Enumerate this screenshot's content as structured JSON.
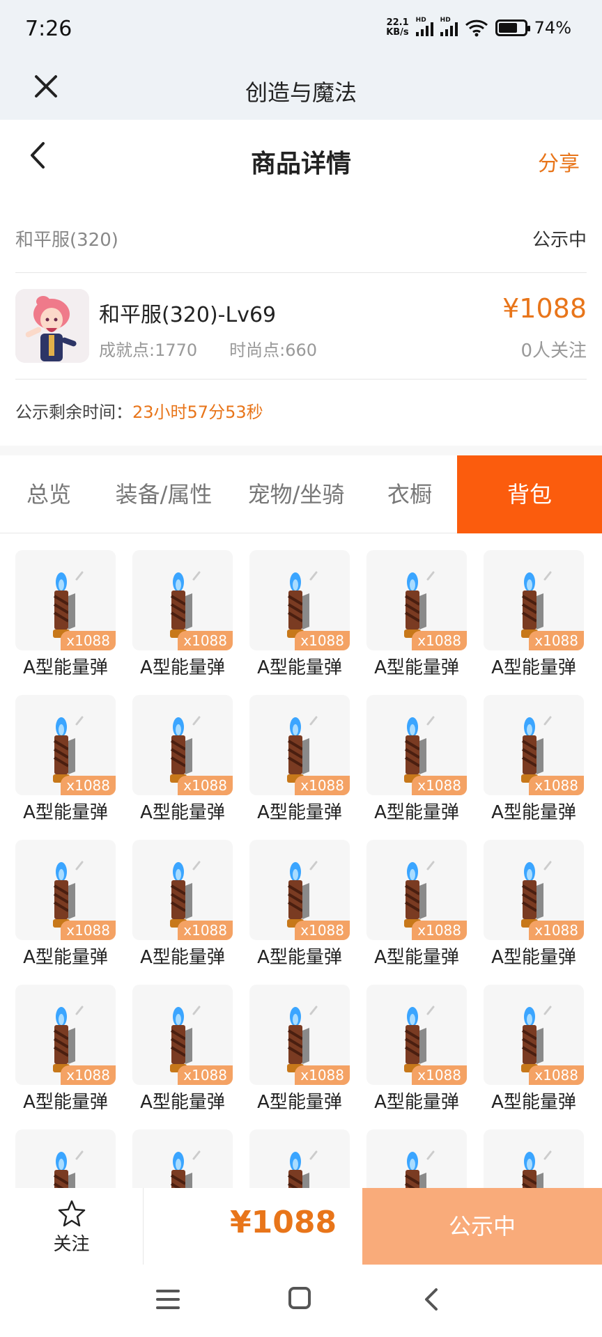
{
  "status_bar": {
    "time": "7:26",
    "net_speed_value": "22.1",
    "net_speed_unit": "KB/s",
    "signal1_label": "HD",
    "signal2_label": "HD",
    "battery_text": "74%",
    "battery_level": 0.74
  },
  "app_bar": {
    "close_icon": "close-icon",
    "title": "创造与魔法"
  },
  "nav": {
    "title": "商品详情",
    "share": "分享"
  },
  "section": {
    "server_name": "和平服(320)",
    "status": "公示中"
  },
  "product": {
    "name": "和平服(320)-Lv69",
    "achievement": "成就点:1770",
    "fashion": "时尚点:660",
    "price": "¥1088",
    "followers": "0人关注"
  },
  "timer": {
    "label": "公示剩余时间：",
    "value": "23小时57分53秒"
  },
  "tabs": [
    {
      "label": "总览"
    },
    {
      "label": "装备/属性"
    },
    {
      "label": "宠物/坐骑"
    },
    {
      "label": "衣橱"
    },
    {
      "label": "背包"
    }
  ],
  "inventory": {
    "items": [
      {
        "name": "A型能量弹",
        "qty": "x1088"
      },
      {
        "name": "A型能量弹",
        "qty": "x1088"
      },
      {
        "name": "A型能量弹",
        "qty": "x1088"
      },
      {
        "name": "A型能量弹",
        "qty": "x1088"
      },
      {
        "name": "A型能量弹",
        "qty": "x1088"
      },
      {
        "name": "A型能量弹",
        "qty": "x1088"
      },
      {
        "name": "A型能量弹",
        "qty": "x1088"
      },
      {
        "name": "A型能量弹",
        "qty": "x1088"
      },
      {
        "name": "A型能量弹",
        "qty": "x1088"
      },
      {
        "name": "A型能量弹",
        "qty": "x1088"
      },
      {
        "name": "A型能量弹",
        "qty": "x1088"
      },
      {
        "name": "A型能量弹",
        "qty": "x1088"
      },
      {
        "name": "A型能量弹",
        "qty": "x1088"
      },
      {
        "name": "A型能量弹",
        "qty": "x1088"
      },
      {
        "name": "A型能量弹",
        "qty": "x1088"
      },
      {
        "name": "A型能量弹",
        "qty": "x1088"
      },
      {
        "name": "A型能量弹",
        "qty": "x1088"
      },
      {
        "name": "A型能量弹",
        "qty": "x1088"
      },
      {
        "name": "A型能量弹",
        "qty": "x1088"
      },
      {
        "name": "A型能量弹",
        "qty": "x1088"
      }
    ],
    "partial_row_count": 5
  },
  "bottom_bar": {
    "follow_label": "关注",
    "price": "¥1088",
    "cta": "公示中"
  },
  "colors": {
    "accent": "#e8751a",
    "active_tab": "#fb5c0d",
    "cta_bg": "#f9ab7a",
    "qty_badge": "#f4a264"
  }
}
